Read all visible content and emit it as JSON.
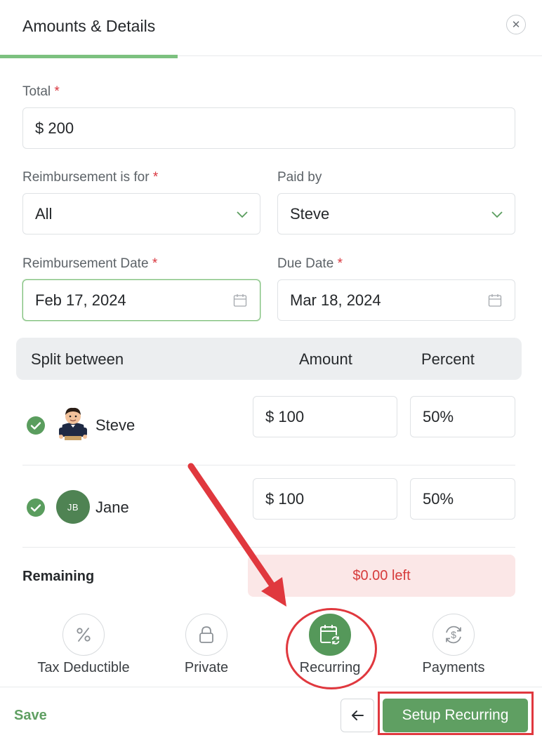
{
  "header": {
    "title": "Amounts & Details",
    "close_icon": "close-icon"
  },
  "form": {
    "total": {
      "label": "Total",
      "required_mark": "*",
      "value": "$ 200"
    },
    "reimbursement_for": {
      "label": "Reimbursement is for",
      "required_mark": "*",
      "value": "All"
    },
    "paid_by": {
      "label": "Paid by",
      "value": "Steve"
    },
    "reimbursement_date": {
      "label": "Reimbursement Date",
      "required_mark": "*",
      "value": "Feb 17, 2024"
    },
    "due_date": {
      "label": "Due Date",
      "required_mark": "*",
      "value": "Mar 18, 2024"
    }
  },
  "split": {
    "header": {
      "name": "Split between",
      "amount": "Amount",
      "percent": "Percent"
    },
    "rows": [
      {
        "name": "Steve",
        "amount": "$ 100",
        "percent": "50%",
        "avatar": "cartoon-avatar"
      },
      {
        "name": "Jane",
        "amount": "$ 100",
        "percent": "50%",
        "initials": "JB"
      }
    ]
  },
  "remaining": {
    "label": "Remaining",
    "value": "$0.00 left"
  },
  "options": [
    {
      "label": "Tax Deductible",
      "icon": "percent-icon"
    },
    {
      "label": "Private",
      "icon": "lock-icon"
    },
    {
      "label": "Recurring",
      "icon": "recurring-calendar-icon"
    },
    {
      "label": "Payments",
      "icon": "dollar-sync-icon"
    }
  ],
  "footer": {
    "save_label": "Save",
    "primary_label": "Setup Recurring"
  },
  "colors": {
    "accent": "#5f9f62",
    "error": "#d63a3a",
    "annotation": "#e0383e"
  }
}
